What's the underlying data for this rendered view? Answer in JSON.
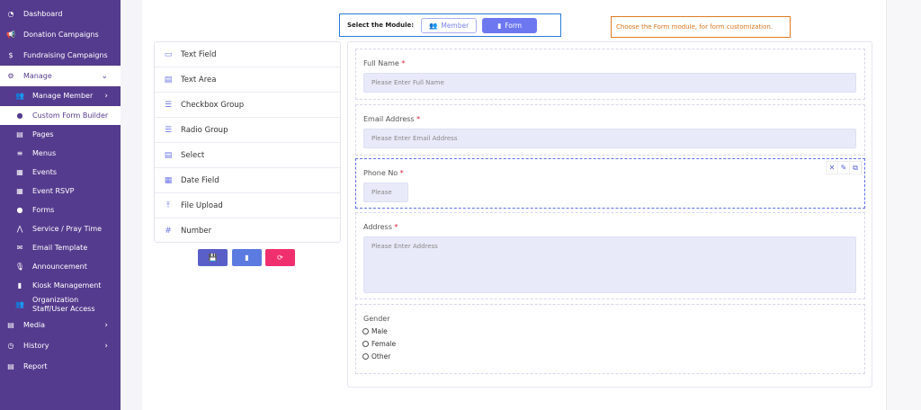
{
  "sidebar": {
    "items": [
      {
        "label": "Dashboard",
        "icon": "dashboard-icon"
      },
      {
        "label": "Donation Campaigns",
        "icon": "megaphone-icon"
      },
      {
        "label": "Fundraising Campaigns",
        "icon": "fundraising-icon"
      },
      {
        "label": "Manage",
        "icon": "gear-icon"
      },
      {
        "label": "Manage Member",
        "icon": "users-icon"
      },
      {
        "label": "Custom Form Builder",
        "icon": "user-icon"
      },
      {
        "label": "Pages",
        "icon": "page-icon"
      },
      {
        "label": "Menus",
        "icon": "menu-icon"
      },
      {
        "label": "Events",
        "icon": "calendar-icon"
      },
      {
        "label": "Event RSVP",
        "icon": "calendar-icon"
      },
      {
        "label": "Forms",
        "icon": "user-icon"
      },
      {
        "label": "Service / Pray Time",
        "icon": "pray-icon"
      },
      {
        "label": "Email Template",
        "icon": "envelope-icon"
      },
      {
        "label": "Announcement",
        "icon": "microphone-icon"
      },
      {
        "label": "Kiosk Management",
        "icon": "bookmark-icon"
      },
      {
        "label": "Organization Staff/User Access",
        "icon": "users-icon"
      },
      {
        "label": "Media",
        "icon": "file-icon"
      },
      {
        "label": "History",
        "icon": "clock-icon"
      },
      {
        "label": "Report",
        "icon": "report-icon"
      }
    ]
  },
  "module": {
    "label": "Select the Module:",
    "member": "Member",
    "form": "Form"
  },
  "hint": "Choose the Form module, for form customization.",
  "palette": [
    {
      "label": "Text Field",
      "icon": "text-field-icon"
    },
    {
      "label": "Text Area",
      "icon": "text-area-icon"
    },
    {
      "label": "Checkbox Group",
      "icon": "checkbox-list-icon"
    },
    {
      "label": "Radio Group",
      "icon": "radio-list-icon"
    },
    {
      "label": "Select",
      "icon": "select-icon"
    },
    {
      "label": "Date Field",
      "icon": "calendar-icon"
    },
    {
      "label": "File Upload",
      "icon": "upload-icon"
    },
    {
      "label": "Number",
      "icon": "hash-icon"
    }
  ],
  "form": {
    "full_name": {
      "label": "Full Name",
      "placeholder": "Please Enter Full Name"
    },
    "email": {
      "label": "Email Address",
      "placeholder": "Please Enter Email Address"
    },
    "phone": {
      "label": "Phone No",
      "placeholder": "Please"
    },
    "address": {
      "label": "Address",
      "placeholder": "Please Enter Address"
    },
    "gender": {
      "label": "Gender",
      "options": [
        "Male",
        "Female",
        "Other"
      ]
    },
    "required_mark": "*"
  },
  "colors": {
    "sidebar": "#553b8e",
    "accent": "#6d78f0",
    "save": "#5a5fc8",
    "preview": "#5b7be0",
    "reset": "#f0306e",
    "hint": "#e07b22"
  }
}
